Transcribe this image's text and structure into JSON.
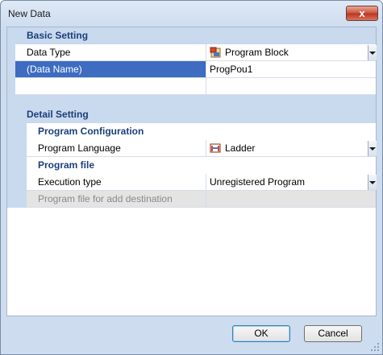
{
  "window": {
    "title": "New Data",
    "close_glyph": "x"
  },
  "basic": {
    "label": "Basic Setting",
    "rows": [
      {
        "name": "Data Type",
        "value": "Program Block",
        "icon": "program-block-icon"
      },
      {
        "name": "(Data Name)",
        "value": "ProgPou1"
      }
    ]
  },
  "detail": {
    "label": "Detail Setting",
    "program_configuration": {
      "label": "Program Configuration",
      "rows": [
        {
          "name": "Program Language",
          "value": "Ladder",
          "icon": "ladder-icon"
        }
      ]
    },
    "program_file": {
      "label": "Program file",
      "rows": [
        {
          "name": "Execution type",
          "value": "Unregistered Program"
        },
        {
          "name": "Program file for add destination",
          "value": ""
        }
      ]
    }
  },
  "buttons": {
    "ok": "OK",
    "cancel": "Cancel"
  },
  "colors": {
    "selection": "#3d6cc0",
    "category": "#c9d9ee",
    "heading_text": "#1b3f7a"
  }
}
